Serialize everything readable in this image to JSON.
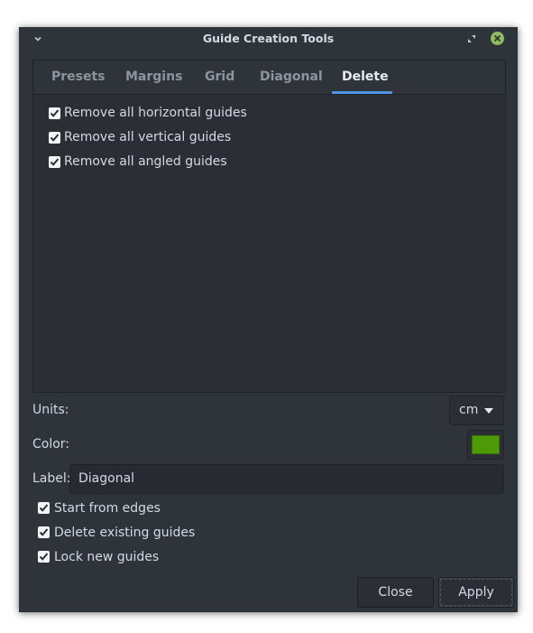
{
  "window": {
    "title": "Guide Creation Tools"
  },
  "tabs": [
    {
      "label": "Presets",
      "active": false
    },
    {
      "label": "Margins",
      "active": false
    },
    {
      "label": "Grid",
      "active": false
    },
    {
      "label": "Diagonal",
      "active": false
    },
    {
      "label": "Delete",
      "active": true
    }
  ],
  "delete_panel": {
    "options": [
      {
        "label": "Remove all horizontal guides",
        "checked": true
      },
      {
        "label": "Remove all vertical guides",
        "checked": true
      },
      {
        "label": "Remove all angled guides",
        "checked": true
      }
    ]
  },
  "units": {
    "label": "Units:",
    "value": "cm"
  },
  "color": {
    "label": "Color:",
    "value": "#4e9a06"
  },
  "guide_label": {
    "label": "Label:",
    "value": "Diagonal"
  },
  "options": [
    {
      "label": "Start from edges",
      "checked": true
    },
    {
      "label": "Delete existing guides",
      "checked": true
    },
    {
      "label": "Lock new guides",
      "checked": true
    }
  ],
  "buttons": {
    "close": "Close",
    "apply": "Apply"
  },
  "colors": {
    "window_bg": "#2f343b",
    "accent": "#5294e2",
    "close_circle": "#8fbc5f"
  },
  "icons": {
    "collapse": "chevron-down-icon",
    "restore": "restore-icon",
    "close": "close-icon",
    "dropdown": "triangle-down-icon",
    "check": "checkmark-icon"
  }
}
